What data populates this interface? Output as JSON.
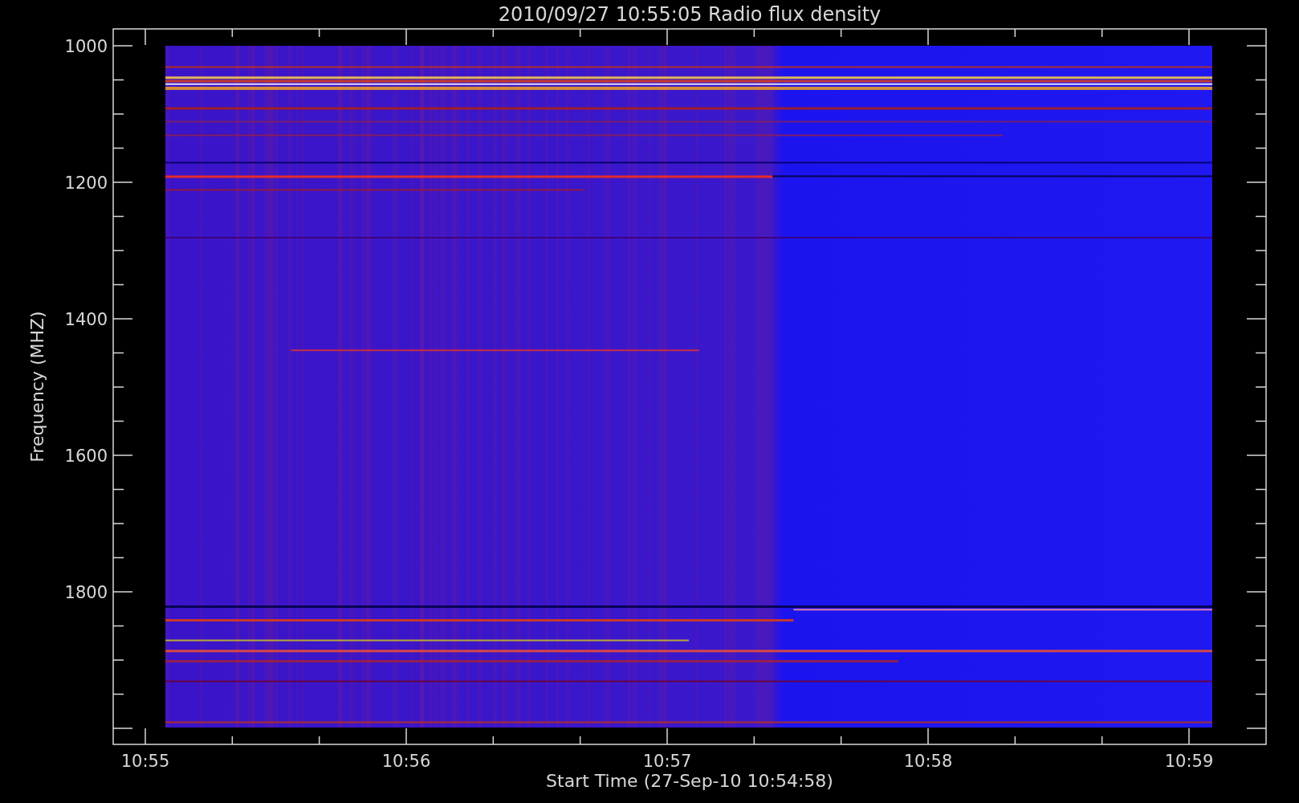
{
  "title": "2010/09/27 10:55:05 Radio flux density",
  "y_axis": {
    "label": "Frequency (MHZ)",
    "ticks": [
      "1000",
      "1200",
      "1400",
      "1600",
      "1800"
    ]
  },
  "x_axis": {
    "label": "Start Time (27-Sep-10 10:54:58)",
    "ticks": [
      "10:55",
      "10:56",
      "10:57",
      "10:58",
      "10:59"
    ]
  }
}
